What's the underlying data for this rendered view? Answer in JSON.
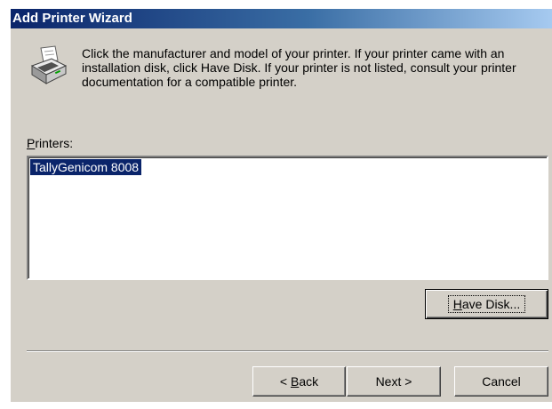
{
  "window": {
    "title": "Add Printer Wizard"
  },
  "instructions": "Click the manufacturer and model of your printer. If your printer came with an installation disk, click Have Disk. If your printer is not listed, consult your printer documentation for a compatible printer.",
  "printers": {
    "label_accel": "P",
    "label_rest": "rinters:",
    "items": [
      "TallyGenicom 8008"
    ],
    "selected_index": 0
  },
  "buttons": {
    "have_disk": {
      "accel": "H",
      "rest": "ave Disk..."
    },
    "back": {
      "prefix": "< ",
      "accel": "B",
      "rest": "ack"
    },
    "next": {
      "label": "Next >"
    },
    "cancel": {
      "label": "Cancel"
    }
  },
  "colors": {
    "dialog_bg": "#d4d0c8",
    "title_start": "#0a246a",
    "title_end": "#a6caf0",
    "selection_bg": "#0a246a"
  },
  "icons": {
    "wizard_icon": "printer-icon"
  }
}
